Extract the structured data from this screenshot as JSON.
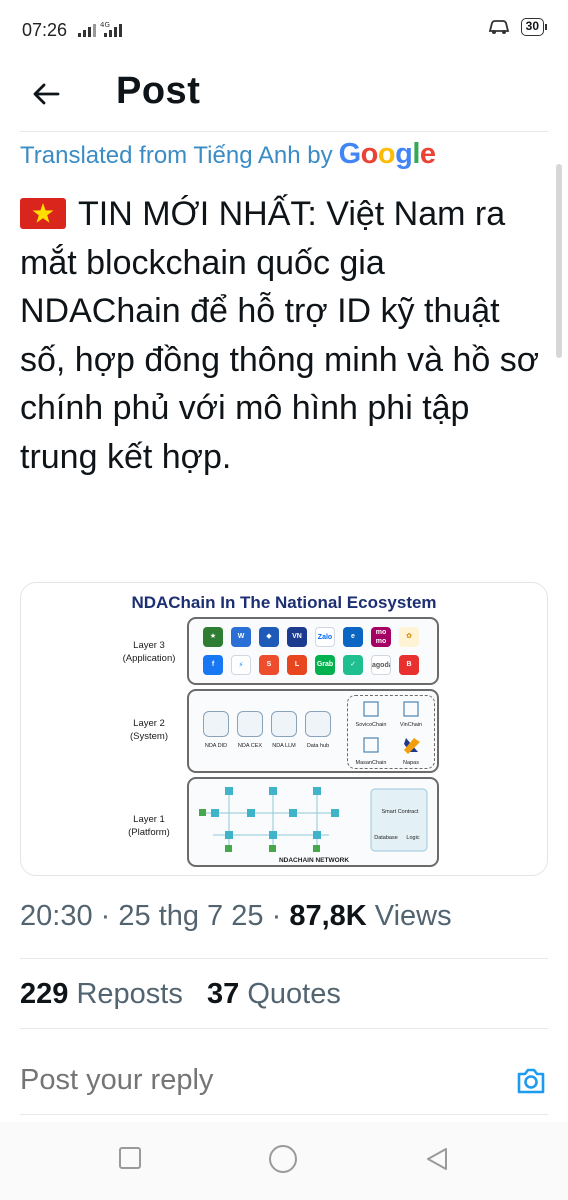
{
  "status_bar": {
    "time": "07:26",
    "network": "4G",
    "battery": "30"
  },
  "header": {
    "title": "Post"
  },
  "post": {
    "translated_prefix": "Translated from Tiếng Anh by",
    "translator_brand": "Google",
    "text": "TIN MỚI NHẤT: Việt Nam ra mắt blockchain quốc gia NDAChain để hỗ trợ ID kỹ thuật số, hợp đồng thông minh và hồ sơ chính phủ với mô hình phi tập trung kết hợp.",
    "flag_icon": "vietnam-flag-icon",
    "meta": {
      "time": "20:30",
      "date": "25 thg 7 25",
      "views_count": "87,8K",
      "views_label": "Views",
      "separator": "·"
    },
    "stats": {
      "reposts_count": "229",
      "reposts_label": "Reposts",
      "quotes_count": "37",
      "quotes_label": "Quotes"
    },
    "media": {
      "title": "NDAChain In The National Ecosystem",
      "layer3_label": "Layer 3\n(Application)",
      "layer2_label": "Layer 2\n(System)",
      "layer1_label": "Layer 1\n(Platform)",
      "app_icons": [
        "W",
        "S",
        "VNVC",
        "Zalo",
        "e",
        "mo mo",
        "f",
        "M",
        "S",
        "Lotte",
        "Grab",
        "V",
        "Agoda",
        "B"
      ],
      "system_items": [
        "NDA DID",
        "NDA CEX",
        "NDA LLM",
        "Data hub"
      ],
      "partner_chains": [
        "SovicoChain",
        "VinChain",
        "MasanChain",
        "Napas"
      ],
      "platform_items": [
        "Smart Contract",
        "Database",
        "Logic"
      ],
      "network_label": "NDACHAIN NETWORK"
    }
  },
  "reply": {
    "placeholder": "Post your reply"
  },
  "colors": {
    "link_blue": "#3b8cc4",
    "muted": "#536471",
    "text": "#0f1419",
    "accent": "#1d9bf0"
  }
}
